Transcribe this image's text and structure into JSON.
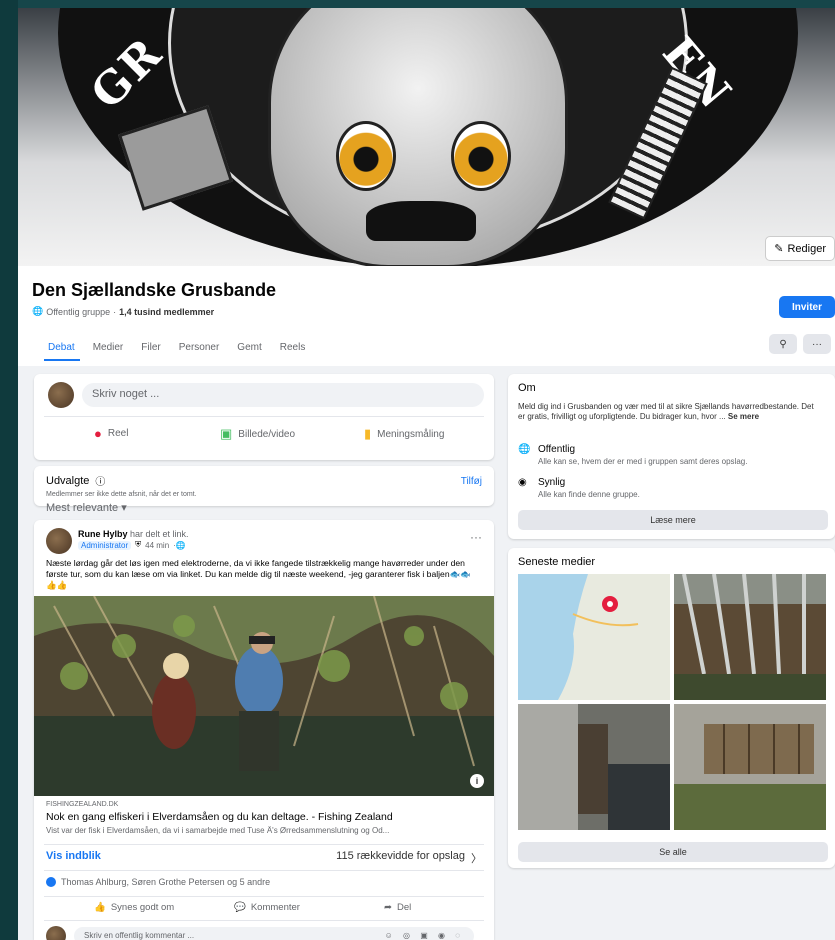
{
  "cover": {
    "text_left": "GR",
    "text_right": "EN",
    "edit_label": "Rediger"
  },
  "group": {
    "title": "Den Sjællandske Grusbande",
    "privacy": "Offentlig gruppe",
    "members": "1,4 tusind medlemmer",
    "invite_label": "Inviter"
  },
  "tabs": [
    {
      "label": "Debat",
      "active": true
    },
    {
      "label": "Medier"
    },
    {
      "label": "Filer"
    },
    {
      "label": "Personer"
    },
    {
      "label": "Gemt"
    },
    {
      "label": "Reels"
    }
  ],
  "composer": {
    "placeholder": "Skriv noget ...",
    "actions": {
      "reel": "Reel",
      "photo": "Billede/video",
      "poll": "Meningsmåling"
    }
  },
  "featured": {
    "title": "Udvalgte",
    "subtitle": "Medlemmer ser ikke dette afsnit, når det er tomt.",
    "add": "Tilføj"
  },
  "sort_label": "Mest relevante",
  "post": {
    "author": "Rune Hylby",
    "action": "har delt et link.",
    "role": "Administrator",
    "time": "44 min",
    "text": "Næste lørdag går det løs igen med elektroderne, da vi ikke fangede tilstrækkelig mange havørreder under den første tur, som du kan læse om via linket. Du kan melde dig til næste weekend, -jeg garanterer fisk i baljen🐟🐟👍👍",
    "link_source": "FISHINGZEALAND.DK",
    "link_title": "Nok en gang elfiskeri i Elverdamsåen og du kan deltage. - Fishing Zealand",
    "link_subtitle": "Vist var der fisk i Elverdamsåen, da vi i samarbejde med Tuse Å's Ørredsammenslutning og Od...",
    "insight": "Vis indblik",
    "reach": "115 rækkevidde for opslag",
    "reactions": "Thomas Ahlburg, Søren Grothe Petersen og 5 andre",
    "like": "Synes godt om",
    "comment": "Kommenter",
    "share": "Del",
    "comment_placeholder": "Skriv en offentlig kommentar ..."
  },
  "about": {
    "title": "Om",
    "description": "Meld dig ind i Grusbanden og vær med til at sikre Sjællands havørredbestande. Det er gratis, frivilligt og uforpligtende. Du bidrager kun, hvor ...",
    "see_more": "Se mere",
    "public_title": "Offentlig",
    "public_desc": "Alle kan se, hvem der er med i gruppen samt deres opslag.",
    "visible_title": "Synlig",
    "visible_desc": "Alle kan finde denne gruppe.",
    "more_button": "Læse mere"
  },
  "media": {
    "title": "Seneste medier",
    "see_all": "Se alle"
  },
  "colors": {
    "accent": "#1877f2",
    "background": "#16464a"
  }
}
